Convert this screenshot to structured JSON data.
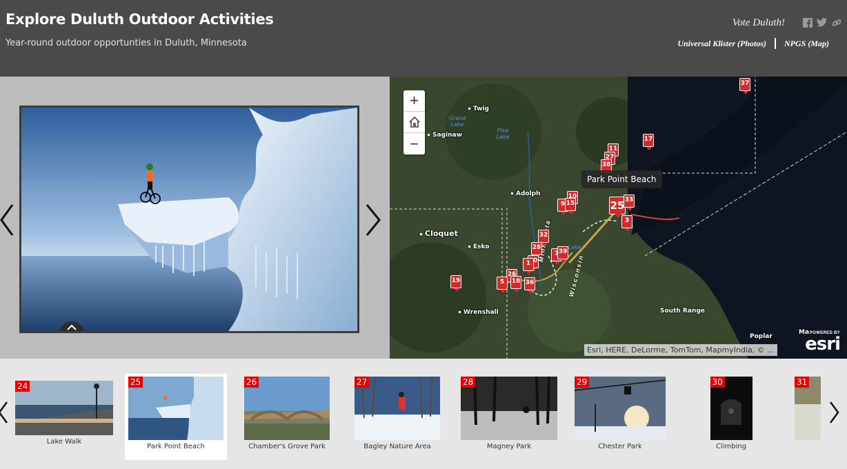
{
  "header": {
    "title": "Explore Duluth Outdoor Activities",
    "subtitle": "Year-round outdoor opportunties in Duluth, Minnesota",
    "vote_text": "Vote Duluth!",
    "social_icons": [
      "facebook-icon",
      "twitter-icon",
      "link-icon"
    ],
    "credit_photos": "Universal Klister (Photos)",
    "credit_map": "NPGS (Map)"
  },
  "map": {
    "tooltip": "Park Point Beach",
    "attribution": "Esri, HERE, DeLorme, TomTom, MapmyIndia, © ...",
    "logo_powered": "POWERED BY",
    "logo_brand": "esri",
    "places": [
      "Twig",
      "Saginaw",
      "Adolph",
      "Cloquet",
      "Esko",
      "Wrenshall",
      "South Range",
      "Poplar",
      "Ma"
    ],
    "water": [
      "Grand Lake",
      "Pike Lake",
      "Lake"
    ],
    "states": [
      "Minnesota",
      "Wisconsin"
    ],
    "markers": [
      "37",
      "17",
      "11",
      "27",
      "38",
      "10",
      "9",
      "15",
      "25",
      "33",
      "3",
      "32",
      "28",
      "7",
      "39",
      "30",
      "1",
      "26",
      "5",
      "18",
      "36",
      "19"
    ]
  },
  "carousel": {
    "items": [
      {
        "num": "24",
        "label": "Lake Walk"
      },
      {
        "num": "25",
        "label": "Park Point Beach"
      },
      {
        "num": "26",
        "label": "Chamber's Grove Park"
      },
      {
        "num": "27",
        "label": "Bagley Nature Area"
      },
      {
        "num": "28",
        "label": "Magney Park"
      },
      {
        "num": "29",
        "label": "Chester Park"
      },
      {
        "num": "30",
        "label": "Climbing"
      },
      {
        "num": "31",
        "label": ""
      }
    ]
  },
  "colors": {
    "header_bg": "#4a4a4a",
    "marker_red": "#d32a2a",
    "badge_red": "#e20000"
  }
}
